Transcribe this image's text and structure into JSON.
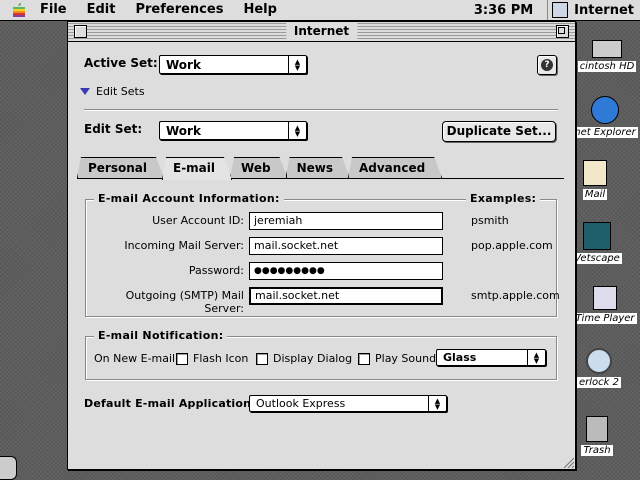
{
  "menubar": {
    "menus": [
      "File",
      "Edit",
      "Preferences",
      "Help"
    ],
    "clock": "3:36 PM",
    "active_app": "Internet"
  },
  "desktop": {
    "icons": [
      {
        "label": "cintosh HD"
      },
      {
        "label": "net Explorer"
      },
      {
        "label": "Mail"
      },
      {
        "label": "Vetscape"
      },
      {
        "label": "Time Player"
      },
      {
        "label": "erlock 2"
      },
      {
        "label": "Trash"
      }
    ]
  },
  "window": {
    "title": "Internet",
    "active_set_label": "Active Set:",
    "active_set_value": "Work",
    "edit_sets_label": "Edit Sets",
    "edit_set_label": "Edit Set:",
    "edit_set_value": "Work",
    "duplicate_button": "Duplicate Set...",
    "tabs": [
      "Personal",
      "E-mail",
      "Web",
      "News",
      "Advanced"
    ],
    "active_tab": "E-mail",
    "account": {
      "group_title": "E-mail Account Information:",
      "examples_label": "Examples:",
      "fields": [
        {
          "label": "User Account ID:",
          "value": "jeremiah",
          "example": "psmith"
        },
        {
          "label": "Incoming Mail Server:",
          "value": "mail.socket.net",
          "example": "pop.apple.com"
        },
        {
          "label": "Password:",
          "value": "●●●●●●●●●",
          "example": ""
        },
        {
          "label": "Outgoing (SMTP) Mail Server:",
          "value": "mail.socket.net",
          "example": "smtp.apple.com"
        }
      ]
    },
    "notification": {
      "group_title": "E-mail Notification:",
      "on_new_label": "On New E-mail:",
      "flash_icon": "Flash Icon",
      "display_dialog": "Display Dialog",
      "play_sound": "Play Sound:",
      "sound_value": "Glass"
    },
    "default_app_label": "Default E-mail Application:",
    "default_app_value": "Outlook Express"
  }
}
